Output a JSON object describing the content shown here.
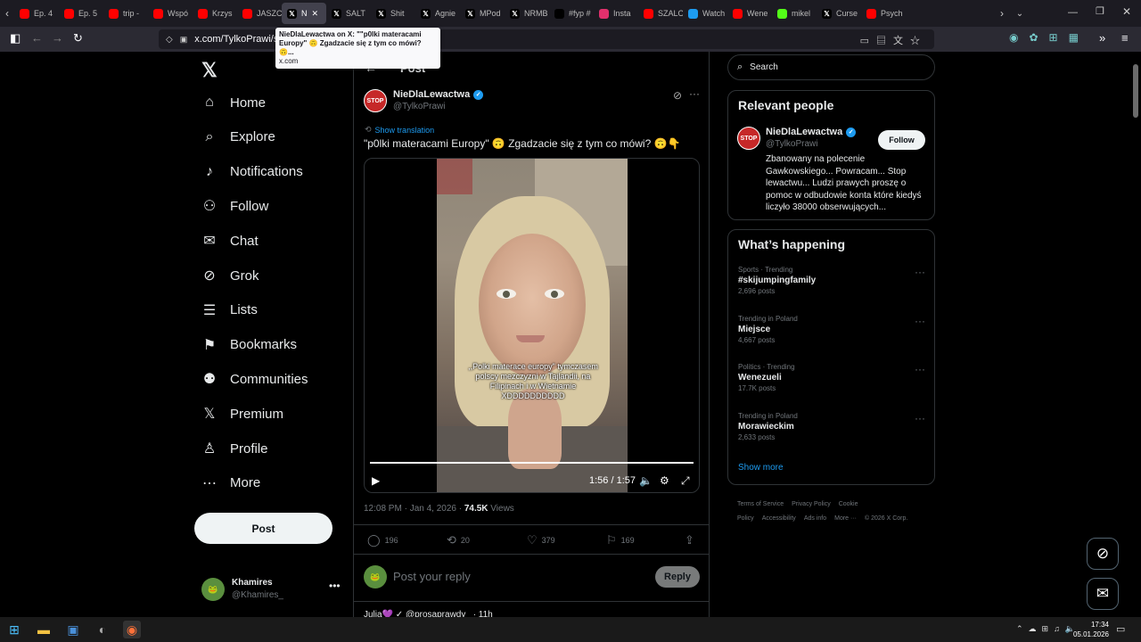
{
  "browser": {
    "tabs": [
      {
        "label": "Ep. 4",
        "fav": "yt",
        "color": "#ff0000"
      },
      {
        "label": "Ep. 5",
        "fav": "yt",
        "color": "#ff0000"
      },
      {
        "label": "trip -",
        "fav": "yt",
        "color": "#ff0000"
      },
      {
        "label": "Wspó",
        "fav": "yt",
        "color": "#ff0000"
      },
      {
        "label": "Krzys",
        "fav": "yt",
        "color": "#ff0000"
      },
      {
        "label": "JASZC",
        "fav": "yt",
        "color": "#ff0000"
      },
      {
        "label": "N",
        "fav": "x",
        "color": "#000000",
        "active": true
      },
      {
        "label": "SALT",
        "fav": "x",
        "color": "#000000"
      },
      {
        "label": "Shit",
        "fav": "x",
        "color": "#000000"
      },
      {
        "label": "Agnie",
        "fav": "x",
        "color": "#000000"
      },
      {
        "label": "MPod",
        "fav": "x",
        "color": "#000000"
      },
      {
        "label": "NRMB",
        "fav": "x",
        "color": "#000000"
      },
      {
        "label": "#fyp #",
        "fav": "tiktok",
        "color": "#000000"
      },
      {
        "label": "Insta",
        "fav": "ig",
        "color": "#e1306c"
      },
      {
        "label": "SZALO",
        "fav": "yt",
        "color": "#ff0000"
      },
      {
        "label": "Watch",
        "fav": "tw",
        "color": "#1d9bf0"
      },
      {
        "label": "Wene",
        "fav": "yt",
        "color": "#ff0000"
      },
      {
        "label": "mikel",
        "fav": "k",
        "color": "#53fc18"
      },
      {
        "label": "Curse",
        "fav": "x",
        "color": "#000000"
      },
      {
        "label": "Psych",
        "fav": "yt",
        "color": "#ff0000"
      }
    ],
    "url": "x.com/TylkoPrawi/stat",
    "tooltip_title": "NieDlaLewactwa on X: \"\"p0lki materacami Europy\" 🙃 Zgadzacie się z tym co mówi? 🙃...",
    "tooltip_host": "x.com"
  },
  "sidebar": {
    "logo": "𝕏",
    "items": [
      {
        "label": "Home",
        "icon": "⌂"
      },
      {
        "label": "Explore",
        "icon": "⌕"
      },
      {
        "label": "Notifications",
        "icon": "♪"
      },
      {
        "label": "Follow",
        "icon": "⚇"
      },
      {
        "label": "Chat",
        "icon": "✉"
      },
      {
        "label": "Grok",
        "icon": "⊘"
      },
      {
        "label": "Lists",
        "icon": "☰"
      },
      {
        "label": "Bookmarks",
        "icon": "⚑"
      },
      {
        "label": "Communities",
        "icon": "⚉"
      },
      {
        "label": "Premium",
        "icon": "𝕏"
      },
      {
        "label": "Profile",
        "icon": "♙"
      },
      {
        "label": "More",
        "icon": "⋯"
      }
    ],
    "post_label": "Post",
    "account_name": "Khamires",
    "account_handle": "@Khamires_"
  },
  "post": {
    "header": "Post",
    "author_name": "NieDlaLewactwa",
    "author_handle": "@TylkoPrawi",
    "avatar_text": "STOP",
    "show_translation": "Show translation",
    "text": "\"p0lki materacami Europy\" 🙃 Zgadzacie się z tym co mówi? 🙃👇",
    "caption": ",,Polki materace europy\" tymczasem polscy mezczyzni w Tajlandii, na Filipinach i w Wietnamie XDDDDDDDDDD",
    "video_time": "1:56 / 1:57",
    "video_progress": 0.99,
    "timestamp": "12:08 PM · Jan 4, 2026 · ",
    "views": "74.5K",
    "views_label": " Views",
    "replies": "196",
    "reposts": "20",
    "likes": "379",
    "bookmarks": "169",
    "reply_placeholder": "Post your reply",
    "reply_button": "Reply",
    "next_reply": "Julia💜 ✓ @prosaprawdy_ · 11h"
  },
  "right": {
    "search_placeholder": "Search",
    "relevant_title": "Relevant people",
    "person_name": "NieDlaLewactwa",
    "person_handle": "@TylkoPrawi",
    "follow_label": "Follow",
    "person_bio": "Zbanowany na polecenie Gawkowskiego... Powracam... Stop lewactwu... Ludzi prawych proszę o pomoc w odbudowie konta które kiedyś liczyło 38000 obserwujących...",
    "happening_title": "What’s happening",
    "trends": [
      {
        "category": "Sports · Trending",
        "title": "#skijumpingfamily",
        "count": "2,696 posts"
      },
      {
        "category": "Trending in Poland",
        "title": "Miejsce",
        "count": "4,667 posts"
      },
      {
        "category": "Politics · Trending",
        "title": "Wenezueli",
        "count": "17.7K posts"
      },
      {
        "category": "Trending in Poland",
        "title": "Morawieckim",
        "count": "2,633 posts"
      }
    ],
    "show_more": "Show more",
    "footer_links": [
      "Terms of Service",
      "Privacy Policy",
      "Cookie Policy",
      "Accessibility",
      "Ads info",
      "More ···",
      "© 2026 X Corp."
    ]
  },
  "taskbar": {
    "time": "17:34",
    "date": "05.01.2026"
  }
}
